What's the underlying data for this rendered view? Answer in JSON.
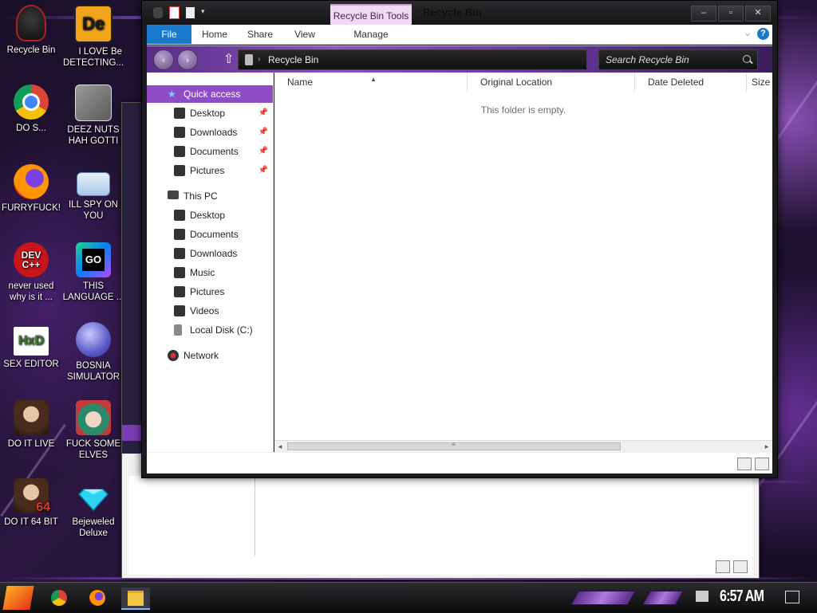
{
  "desktop": {
    "icons": [
      {
        "label": "Recycle Bin",
        "icon": "recycle-bin-icon"
      },
      {
        "label": "I LOVE DETECTING...",
        "icon": "detective-app-icon",
        "mark": "De"
      },
      {
        "label": "Be",
        "icon": "partial-icon"
      },
      {
        "label": "DO S...",
        "icon": "chrome-icon"
      },
      {
        "label": "DEEZ NUTS HAH GOTTI",
        "icon": "stacked-windows-icon"
      },
      {
        "label": "FURRYFUCK!",
        "icon": "firefox-icon"
      },
      {
        "label": "ILL SPY ON YOU",
        "icon": "remote-desktop-icon"
      },
      {
        "label": "never used why is it ...",
        "icon": "dev-cpp-icon",
        "mark": "DEV C++"
      },
      {
        "label": "THIS LANGUAGE ...",
        "icon": "goland-icon",
        "mark": "GO"
      },
      {
        "label": "SEX EDITOR",
        "icon": "hxd-icon",
        "mark": "HxD"
      },
      {
        "label": "BOSNIA SIMULATOR",
        "icon": "mine-icon"
      },
      {
        "label": "DO IT LIVE",
        "icon": "portrait-icon"
      },
      {
        "label": "FUCK SOME ELVES",
        "icon": "elf-portrait-icon"
      },
      {
        "label": "DO IT 64 BIT",
        "icon": "portrait-64-icon",
        "mark": "64"
      },
      {
        "label": "Bejeweled Deluxe",
        "icon": "diamond-icon"
      }
    ]
  },
  "window": {
    "title": "Recycle Bin",
    "contextual_tab": "Recycle Bin Tools",
    "ribbon_tabs": [
      "File",
      "Home",
      "Share",
      "View",
      "Manage"
    ],
    "address": "Recycle Bin",
    "search_placeholder": "Search Recycle Bin",
    "columns": [
      "Name",
      "Original Location",
      "Date Deleted",
      "Size"
    ],
    "empty_message": "This folder is empty.",
    "nav": {
      "quick_access": "Quick access",
      "quick_items": [
        "Desktop",
        "Downloads",
        "Documents",
        "Pictures"
      ],
      "this_pc": "This PC",
      "pc_items": [
        "Desktop",
        "Documents",
        "Downloads",
        "Music",
        "Pictures",
        "Videos",
        "Local Disk (C:)"
      ],
      "network": "Network"
    }
  },
  "taskbar": {
    "clock": "6:57 AM",
    "apps": [
      "start-icon",
      "chrome-icon",
      "firefox-icon",
      "file-explorer-icon"
    ]
  },
  "colors": {
    "accent_purple": "#8e4cc6",
    "file_tab_blue": "#1979ca",
    "tools_tab_pink": "#f1d9f5"
  }
}
